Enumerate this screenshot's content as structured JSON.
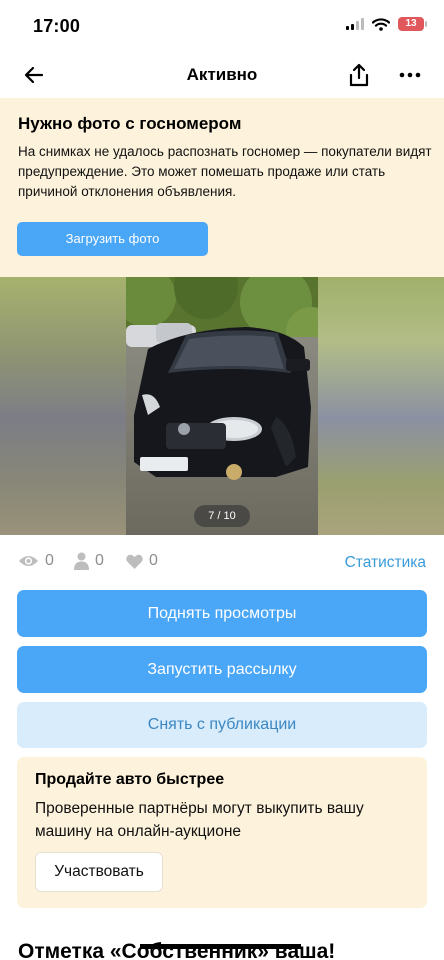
{
  "status_bar": {
    "time": "17:00",
    "battery": "13"
  },
  "nav": {
    "title": "Активно"
  },
  "warning": {
    "title": "Нужно фото с госномером",
    "text": "На снимках не удалось распознать госномер — покупатели видят предупреждение. Это может помешать продаже или стать причиной отклонения объявления.",
    "button": "Загрузить фото"
  },
  "gallery": {
    "counter": "7 / 10"
  },
  "stats": {
    "views": "0",
    "contacts": "0",
    "favorites": "0",
    "link": "Статистика"
  },
  "actions": {
    "boost": "Поднять просмотры",
    "mailing": "Запустить рассылку",
    "unpublish": "Снять с публикации"
  },
  "promo": {
    "title": "Продайте авто быстрее",
    "text": "Проверенные партнёры могут выкупить вашу машину на онлайн-аукционе",
    "button": "Участвовать"
  },
  "bottom_heading": "Отметка «Собственник» ваша!",
  "colors": {
    "accent": "#4aa6f7",
    "link": "#3a9bd9",
    "warning_bg": "#fdf3dc",
    "secondary_bg": "#d8ecfc"
  },
  "icons": [
    "back-arrow-icon",
    "share-icon",
    "more-icon",
    "eye-icon",
    "person-icon",
    "heart-icon",
    "wifi-icon",
    "signal-icon",
    "battery-icon"
  ]
}
